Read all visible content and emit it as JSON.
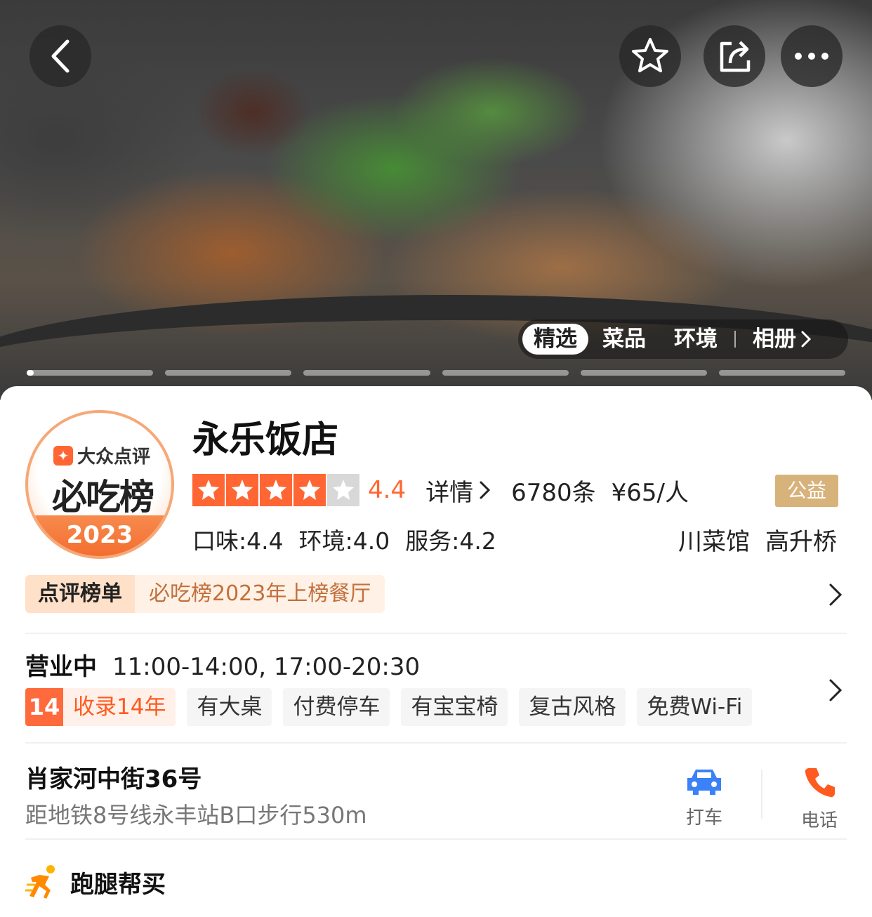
{
  "gallery": {
    "tabs": [
      "精选",
      "菜品",
      "环境"
    ],
    "album_label": "相册",
    "active_tab": "精选",
    "slides_total": 6,
    "slide_active": 1
  },
  "badge": {
    "brand": "大众点评",
    "title": "必吃榜",
    "year": "2023"
  },
  "shop": {
    "name": "永乐饭店",
    "rating": "4.4",
    "stars_filled": 4,
    "stars_total": 5,
    "detail_label": "详情",
    "reviews": "6780条",
    "price": "¥65/人",
    "charity_label": "公益",
    "sub_scores": [
      "口味:4.4",
      "环境:4.0",
      "服务:4.2"
    ],
    "category": "川菜馆",
    "area": "高升桥"
  },
  "ranking": {
    "tag": "点评榜单",
    "text": "必吃榜2023年上榜餐厅"
  },
  "hours": {
    "status": "营业中",
    "time": "11:00-14:00, 17:00-20:30"
  },
  "tags": {
    "years_num": "14",
    "years_text": "收录14年",
    "items": [
      "有大桌",
      "付费停车",
      "有宝宝椅",
      "复古风格",
      "免费Wi-Fi"
    ]
  },
  "location": {
    "address": "肖家河中街36号",
    "metro": "距地铁8号线永丰站B口步行530m",
    "taxi_label": "打车",
    "phone_label": "电话"
  },
  "errand": {
    "label": "跑腿帮买"
  },
  "colors": {
    "accent": "#ff6633",
    "gold": "#d7b27a",
    "taxi_blue": "#3b82f6"
  }
}
